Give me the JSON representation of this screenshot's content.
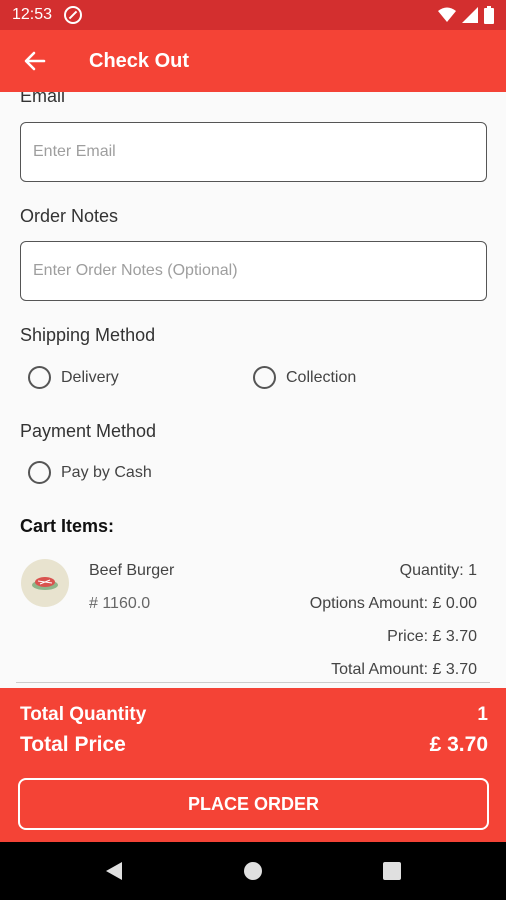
{
  "status_bar": {
    "time": "12:53"
  },
  "app_bar": {
    "title": "Check Out"
  },
  "form": {
    "email": {
      "label": "Email",
      "placeholder": "Enter Email",
      "value": ""
    },
    "order_notes": {
      "label": "Order Notes",
      "placeholder": "Enter Order Notes (Optional)",
      "value": ""
    },
    "shipping": {
      "label": "Shipping Method",
      "options": [
        "Delivery",
        "Collection"
      ]
    },
    "payment": {
      "label": "Payment Method",
      "options": [
        "Pay by Cash"
      ]
    }
  },
  "cart": {
    "title": "Cart Items:",
    "items": [
      {
        "name": "Beef Burger",
        "code": "# 1160.0",
        "quantity": "Quantity: 1",
        "options_amount": "Options Amount: £ 0.00",
        "price": "Price: £ 3.70",
        "total_amount": "Total Amount: £ 3.70"
      }
    ]
  },
  "summary": {
    "total_quantity_label": "Total Quantity",
    "total_quantity_value": "1",
    "total_price_label": "Total Price",
    "total_price_value": "£ 3.70",
    "place_order_label": "PLACE ORDER"
  },
  "colors": {
    "primary": "#f44336",
    "status_bar": "#d32f2f",
    "nav_bar": "#000000"
  },
  "icons": [
    "dnd-icon",
    "wifi-icon",
    "signal-icon",
    "battery-icon",
    "back-arrow-icon",
    "burger-thumbnail",
    "nav-back-icon",
    "nav-home-icon",
    "nav-recents-icon"
  ]
}
